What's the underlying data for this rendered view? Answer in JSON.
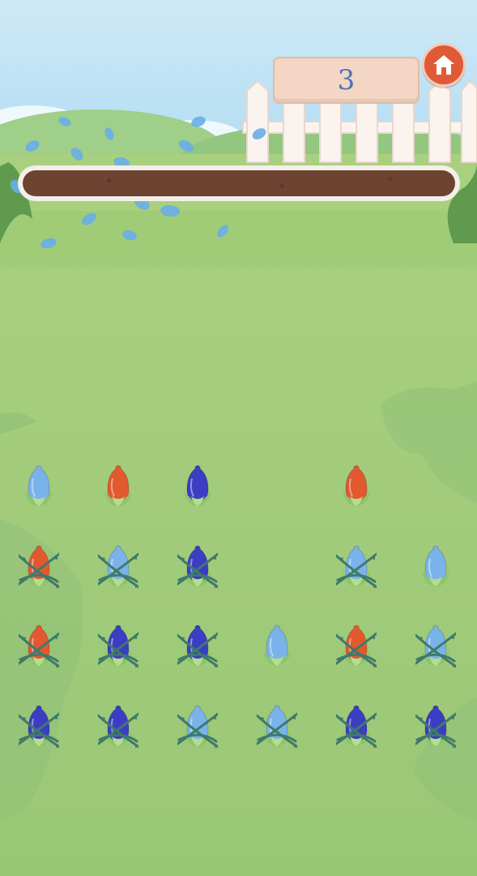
{
  "game": {
    "score": "3",
    "home_icon": "home-icon",
    "colors": {
      "red": "#e2582f",
      "light_blue": "#79b3ea",
      "dark_blue": "#3b3dc2",
      "leaf": "#8dc66a",
      "vine": "#3f7a6b",
      "home_button": "#df5a36"
    }
  },
  "grid": [
    [
      {
        "color": "light_blue",
        "tangled": false
      },
      {
        "color": "red",
        "tangled": false
      },
      {
        "color": "dark_blue",
        "tangled": false
      },
      null,
      {
        "color": "red",
        "tangled": false
      },
      null
    ],
    [
      {
        "color": "red",
        "tangled": true
      },
      {
        "color": "light_blue",
        "tangled": true
      },
      {
        "color": "dark_blue",
        "tangled": true
      },
      null,
      {
        "color": "light_blue",
        "tangled": true
      },
      {
        "color": "light_blue",
        "tangled": false
      }
    ],
    [
      {
        "color": "red",
        "tangled": true
      },
      {
        "color": "dark_blue",
        "tangled": true
      },
      {
        "color": "dark_blue",
        "tangled": true
      },
      {
        "color": "light_blue",
        "tangled": false
      },
      {
        "color": "red",
        "tangled": true
      },
      {
        "color": "light_blue",
        "tangled": true
      }
    ],
    [
      {
        "color": "dark_blue",
        "tangled": true
      },
      {
        "color": "dark_blue",
        "tangled": true
      },
      {
        "color": "light_blue",
        "tangled": true
      },
      {
        "color": "light_blue",
        "tangled": true
      },
      {
        "color": "dark_blue",
        "tangled": true
      },
      {
        "color": "dark_blue",
        "tangled": true
      }
    ]
  ]
}
